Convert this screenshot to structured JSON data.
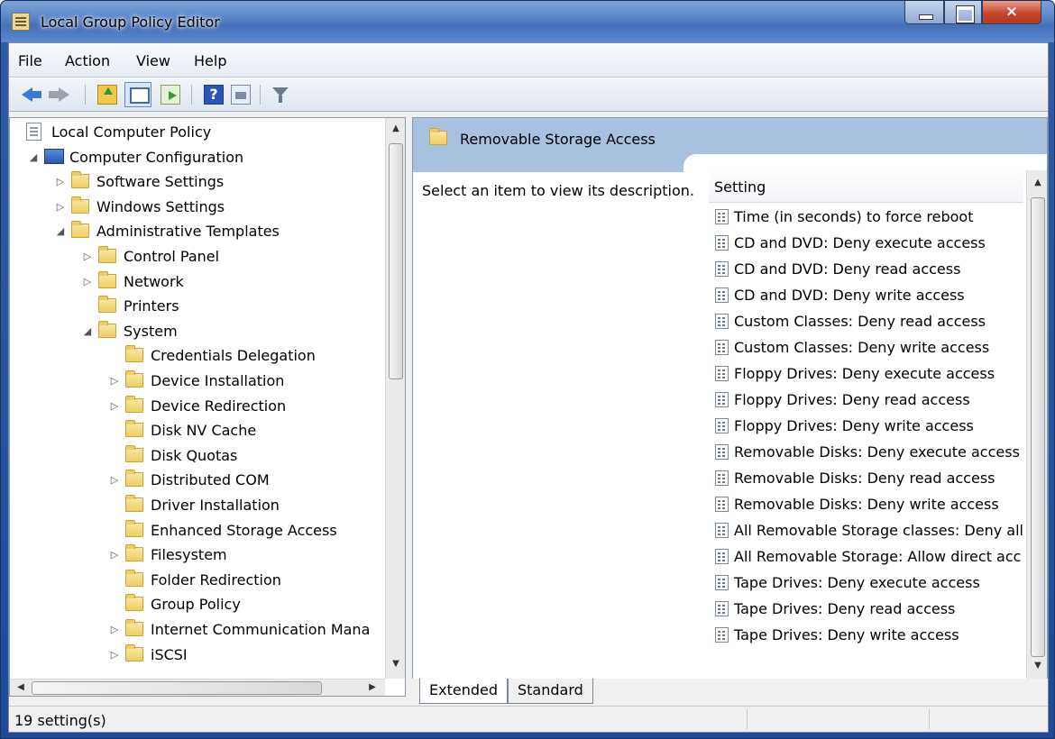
{
  "window": {
    "title": "Local Group Policy Editor"
  },
  "menu": [
    "File",
    "Action",
    "View",
    "Help"
  ],
  "toolbar": {
    "icons": [
      "back-arrow-icon",
      "forward-arrow-icon",
      "up-folder-icon",
      "show-hide-tree-icon",
      "export-list-icon",
      "help-icon",
      "properties-icon",
      "filter-icon"
    ],
    "help_glyph": "?"
  },
  "tree": {
    "items": [
      {
        "label": "Local Computer Policy",
        "level": 0,
        "expander": "",
        "icon": "policy"
      },
      {
        "label": "Computer Configuration",
        "level": 1,
        "expander": "◢",
        "icon": "computer"
      },
      {
        "label": "Software Settings",
        "level": 2,
        "expander": "▷",
        "icon": "folder"
      },
      {
        "label": "Windows Settings",
        "level": 2,
        "expander": "▷",
        "icon": "folder"
      },
      {
        "label": "Administrative Templates",
        "level": 2,
        "expander": "◢",
        "icon": "folder"
      },
      {
        "label": "Control Panel",
        "level": 3,
        "expander": "▷",
        "icon": "folder"
      },
      {
        "label": "Network",
        "level": 3,
        "expander": "▷",
        "icon": "folder"
      },
      {
        "label": "Printers",
        "level": 3,
        "expander": "",
        "icon": "folder"
      },
      {
        "label": "System",
        "level": 3,
        "expander": "◢",
        "icon": "folder"
      },
      {
        "label": "Credentials Delegation",
        "level": 4,
        "expander": "",
        "icon": "folder"
      },
      {
        "label": "Device Installation",
        "level": 4,
        "expander": "▷",
        "icon": "folder"
      },
      {
        "label": "Device Redirection",
        "level": 4,
        "expander": "▷",
        "icon": "folder"
      },
      {
        "label": "Disk NV Cache",
        "level": 4,
        "expander": "",
        "icon": "folder"
      },
      {
        "label": "Disk Quotas",
        "level": 4,
        "expander": "",
        "icon": "folder"
      },
      {
        "label": "Distributed COM",
        "level": 4,
        "expander": "▷",
        "icon": "folder"
      },
      {
        "label": "Driver Installation",
        "level": 4,
        "expander": "",
        "icon": "folder"
      },
      {
        "label": "Enhanced Storage Access",
        "level": 4,
        "expander": "",
        "icon": "folder"
      },
      {
        "label": "Filesystem",
        "level": 4,
        "expander": "▷",
        "icon": "folder"
      },
      {
        "label": "Folder Redirection",
        "level": 4,
        "expander": "",
        "icon": "folder"
      },
      {
        "label": "Group Policy",
        "level": 4,
        "expander": "",
        "icon": "folder"
      },
      {
        "label": "Internet Communication Mana",
        "level": 4,
        "expander": "▷",
        "icon": "folder"
      },
      {
        "label": "iSCSI",
        "level": 4,
        "expander": "▷",
        "icon": "folder"
      }
    ]
  },
  "right": {
    "title": "Removable Storage Access",
    "description": "Select an item to view its description.",
    "column_header": "Setting",
    "settings": [
      "Time (in seconds) to force reboot",
      "CD and DVD: Deny execute access",
      "CD and DVD: Deny read access",
      "CD and DVD: Deny write access",
      "Custom Classes: Deny read access",
      "Custom Classes: Deny write access",
      "Floppy Drives: Deny execute access",
      "Floppy Drives: Deny read access",
      "Floppy Drives: Deny write access",
      "Removable Disks: Deny execute access",
      "Removable Disks: Deny read access",
      "Removable Disks: Deny write access",
      "All Removable Storage classes: Deny all",
      "All Removable Storage: Allow direct acc",
      "Tape Drives: Deny execute access",
      "Tape Drives: Deny read access",
      "Tape Drives: Deny write access"
    ]
  },
  "tabs": [
    "Extended",
    "Standard"
  ],
  "status": {
    "text": "19 setting(s)"
  }
}
